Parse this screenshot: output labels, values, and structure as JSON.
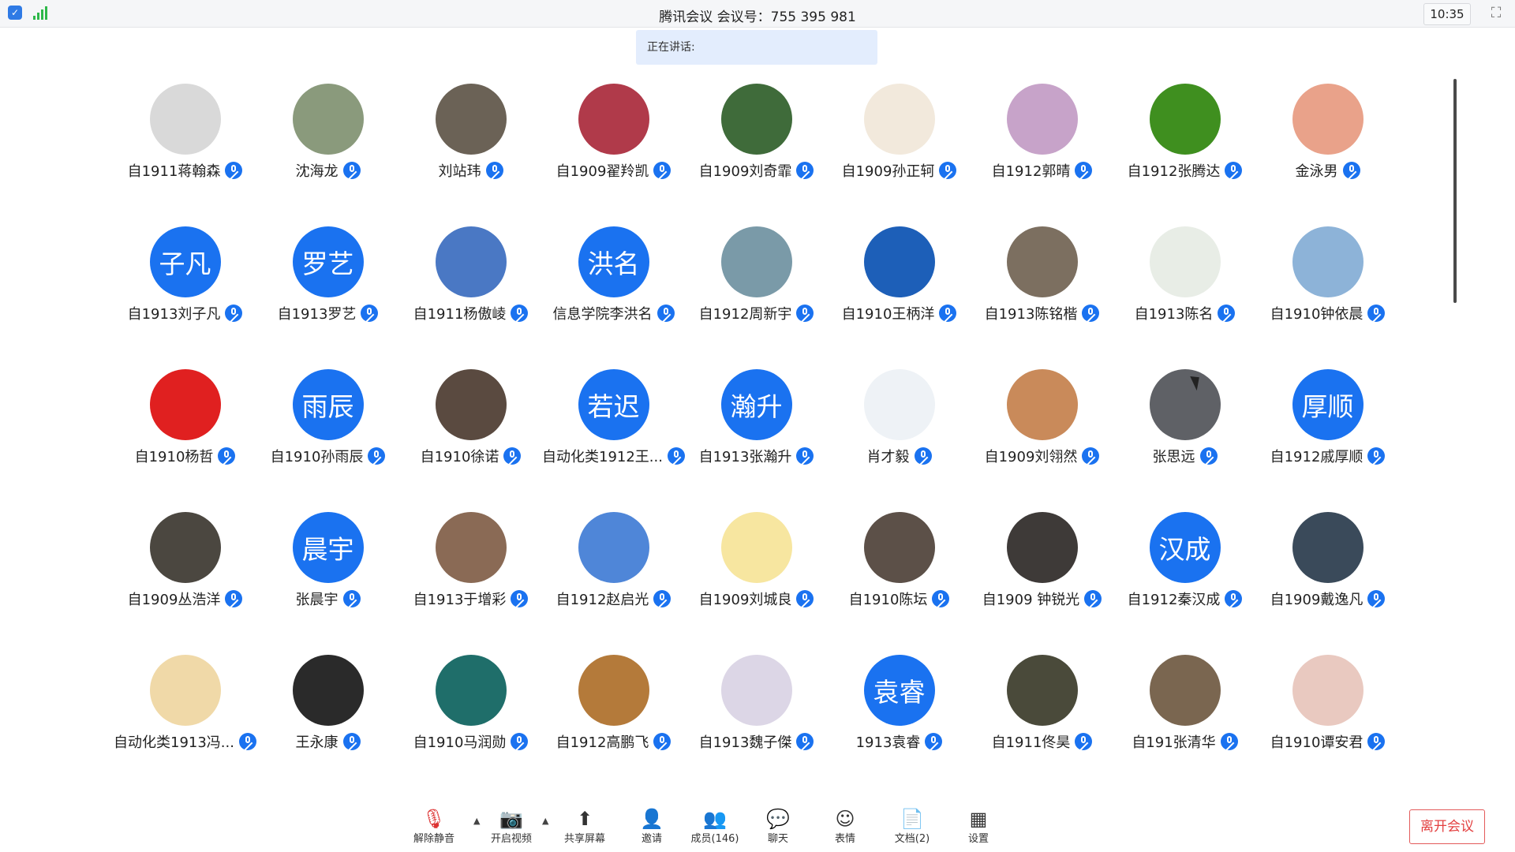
{
  "titlebar": {
    "title": "腾讯会议 会议号：755 395 981",
    "time": "10:35"
  },
  "speaking": {
    "label": "正在讲话:"
  },
  "participants": [
    {
      "name": "自1911蒋翰森",
      "avatar_color": "#d9d9d9"
    },
    {
      "name": "沈海龙",
      "avatar_color": "#8a9a7c"
    },
    {
      "name": "刘站玮",
      "avatar_color": "#6b6256"
    },
    {
      "name": "自1909翟羚凯",
      "avatar_color": "#b03a4a"
    },
    {
      "name": "自1909刘奇霏",
      "avatar_color": "#3f6b3a"
    },
    {
      "name": "自1909孙正轲",
      "avatar_color": "#f2e9dc"
    },
    {
      "name": "自1912郭晴",
      "avatar_color": "#c7a3c9"
    },
    {
      "name": "自1912张腾达",
      "avatar_color": "#3f8f1f"
    },
    {
      "name": "金泳男",
      "avatar_color": "#e9a28a"
    },
    {
      "name": "自1913刘子凡",
      "avatar_text": "子凡"
    },
    {
      "name": "自1913罗艺",
      "avatar_text": "罗艺"
    },
    {
      "name": "自1911杨傲崚",
      "avatar_color": "#4a78c4"
    },
    {
      "name": "信息学院李洪名",
      "avatar_text": "洪名"
    },
    {
      "name": "自1912周新宇",
      "avatar_color": "#7a9aa8"
    },
    {
      "name": "自1910王柄洋",
      "avatar_color": "#1d5fb8"
    },
    {
      "name": "自1913陈铭楷",
      "avatar_color": "#7c6f60"
    },
    {
      "name": "自1913陈名",
      "avatar_color": "#e8ede6"
    },
    {
      "name": "自1910钟依晨",
      "avatar_color": "#8db3d8"
    },
    {
      "name": "自1910杨哲",
      "avatar_color": "#e02020"
    },
    {
      "name": "自1910孙雨辰",
      "avatar_text": "雨辰"
    },
    {
      "name": "自1910徐诺",
      "avatar_color": "#5a4a40"
    },
    {
      "name": "自动化类1912王...",
      "avatar_text": "若迟"
    },
    {
      "name": "自1913张瀚升",
      "avatar_text": "瀚升"
    },
    {
      "name": "肖才毅",
      "avatar_color": "#eef2f6"
    },
    {
      "name": "自1909刘翎然",
      "avatar_color": "#c98a5a"
    },
    {
      "name": "张思远",
      "avatar_color": "#5f6166"
    },
    {
      "name": "自1912戚厚顺",
      "avatar_text": "厚顺"
    },
    {
      "name": "自1909丛浩洋",
      "avatar_color": "#4b4740"
    },
    {
      "name": "张晨宇",
      "avatar_text": "晨宇"
    },
    {
      "name": "自1913于增彩",
      "avatar_color": "#8a6a55"
    },
    {
      "name": "自1912赵启光",
      "avatar_color": "#4f86d8"
    },
    {
      "name": "自1909刘城良",
      "avatar_color": "#f7e6a0"
    },
    {
      "name": "自1910陈坛",
      "avatar_color": "#5c5048"
    },
    {
      "name": "自1909 钟锐光",
      "avatar_color": "#3e3a38"
    },
    {
      "name": "自1912秦汉成",
      "avatar_text": "汉成"
    },
    {
      "name": "自1909戴逸凡",
      "avatar_color": "#3a4a5a"
    },
    {
      "name": "自动化类1913冯...",
      "avatar_color": "#f0d9a8"
    },
    {
      "name": "王永康",
      "avatar_color": "#2a2a2a"
    },
    {
      "name": "自1910马润勋",
      "avatar_color": "#1f6e6a"
    },
    {
      "name": "自1912高鹏飞",
      "avatar_color": "#b47a3a"
    },
    {
      "name": "自1913魏子傑",
      "avatar_color": "#dcd6e6"
    },
    {
      "name": "1913袁睿",
      "avatar_text": "袁睿"
    },
    {
      "name": "自1911佟昊",
      "avatar_color": "#4a4a3a"
    },
    {
      "name": "自191张清华",
      "avatar_color": "#7a6650"
    },
    {
      "name": "自1910谭安君",
      "avatar_color": "#e9c9c0"
    }
  ],
  "toolbar": {
    "unmute": "解除静音",
    "video": "开启视频",
    "share": "共享屏幕",
    "invite": "邀请",
    "members": "成员(146)",
    "chat": "聊天",
    "emoji": "表情",
    "docs": "文档(2)",
    "settings": "设置",
    "leave": "离开会议"
  }
}
